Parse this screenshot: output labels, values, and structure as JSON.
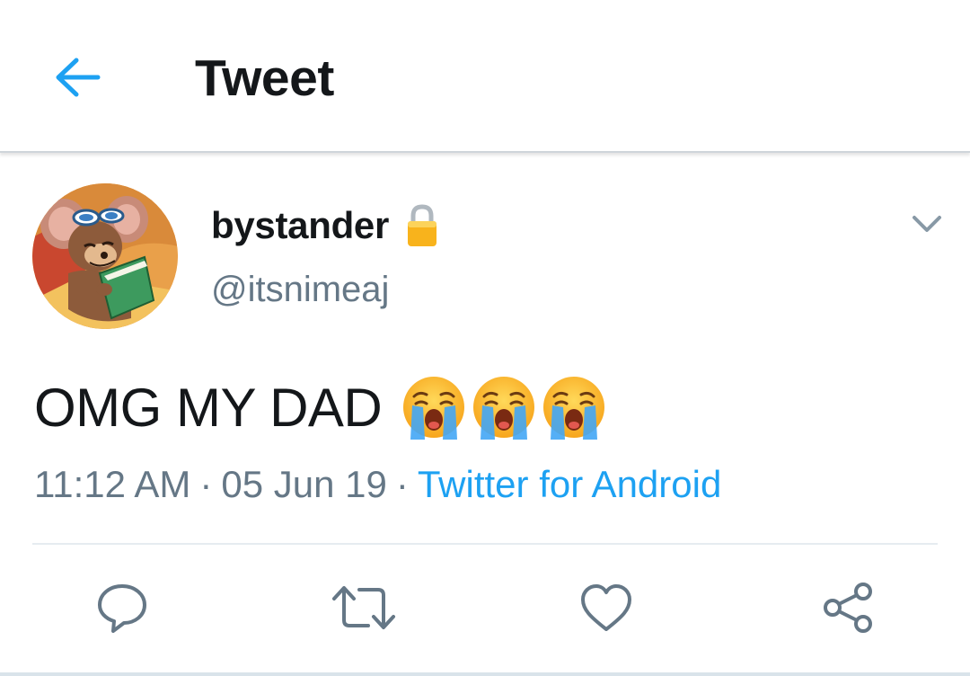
{
  "toolbar": {
    "back_icon": "arrow-left-icon",
    "title": "Tweet",
    "accent_color": "#1da1f2"
  },
  "tweet": {
    "author": {
      "display_name": "bystander",
      "protected_icon": "lock-icon",
      "handle": "@itsnimeaj",
      "avatar_icon": "avatar-cartoon-mouse"
    },
    "caret_icon": "chevron-down-icon",
    "text": "OMG MY DAD",
    "emojis": [
      "😭",
      "😭",
      "😭"
    ],
    "time": "11:12 AM",
    "separator": "·",
    "date": "05 Jun 19",
    "source": "Twitter for Android",
    "actions": [
      {
        "name": "reply",
        "icon": "reply-icon"
      },
      {
        "name": "retweet",
        "icon": "retweet-icon"
      },
      {
        "name": "like",
        "icon": "heart-icon"
      },
      {
        "name": "share",
        "icon": "share-icon"
      }
    ]
  },
  "colors": {
    "text_primary": "#14171a",
    "text_secondary": "#657786",
    "link": "#1da1f2",
    "divider": "#e6ecf0"
  }
}
